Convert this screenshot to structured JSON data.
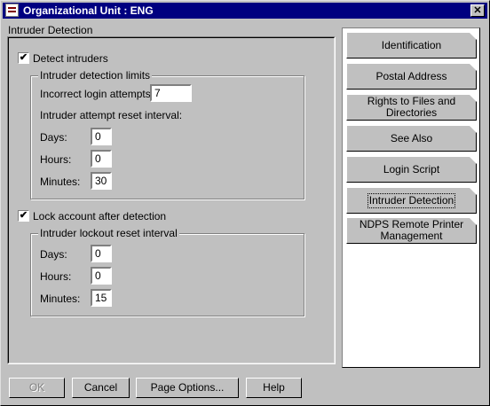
{
  "window": {
    "title": "Organizational Unit : ENG",
    "close_glyph": "✕"
  },
  "section": {
    "title": "Intruder Detection"
  },
  "detect": {
    "checkbox_label": "Detect intruders",
    "checked_glyph": "✔",
    "limits_group_title": "Intruder detection limits",
    "incorrect_login_label": "Incorrect login attempts:",
    "incorrect_login_value": "7",
    "reset_interval_label": "Intruder attempt reset interval:",
    "days_label": "Days:",
    "days_value": "0",
    "hours_label": "Hours:",
    "hours_value": "0",
    "minutes_label": "Minutes:",
    "minutes_value": "30"
  },
  "lock": {
    "checkbox_label": "Lock account after detection",
    "checked_glyph": "✔",
    "group_title": "Intruder lockout reset interval",
    "days_label": "Days:",
    "days_value": "0",
    "hours_label": "Hours:",
    "hours_value": "0",
    "minutes_label": "Minutes:",
    "minutes_value": "15"
  },
  "tabs": [
    {
      "label": "Identification"
    },
    {
      "label": "Postal Address"
    },
    {
      "label": "Rights to Files and Directories"
    },
    {
      "label": "See Also"
    },
    {
      "label": "Login Script"
    },
    {
      "label": "Intruder Detection"
    },
    {
      "label": "NDPS Remote Printer Management"
    }
  ],
  "buttons": {
    "ok": "OK",
    "cancel": "Cancel",
    "page_options": "Page Options...",
    "help": "Help"
  }
}
